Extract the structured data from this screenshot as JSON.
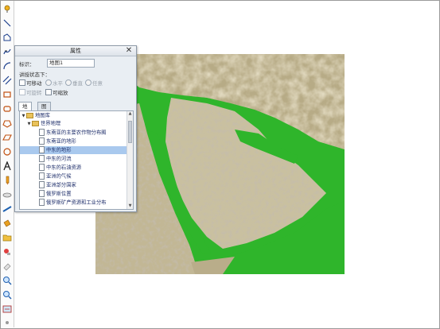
{
  "panel": {
    "title": "属性",
    "id_label": "标识：",
    "id_value": "地图1",
    "state_label": "讲授状态下：",
    "movable_label": "可移动",
    "h_label": "水平",
    "v_label": "垂直",
    "any_label": "任意",
    "rotatable_label": "可旋转",
    "scalable_label": "可缩放",
    "tabs": [
      "地图",
      "图层"
    ],
    "active_tab": 0
  },
  "tree": {
    "root": "地图库",
    "group": "世界地理",
    "items": [
      "东南亚的主要农作物分布图",
      "东南亚的地形",
      "中东的地形",
      "中东的河流",
      "中东的石油资源",
      "亚洲的气候",
      "亚洲部分国家",
      "俄罗斯位置",
      "俄罗斯矿产资源和工业分布"
    ],
    "selected_index": 2
  },
  "toolbar": {
    "icons": [
      "pin-icon",
      "line-icon",
      "polyline-icon",
      "freehand-icon",
      "arc-icon",
      "double-line-icon",
      "rectangle-icon",
      "rounded-rect-icon",
      "polygon-icon",
      "parallelogram-icon",
      "circle-icon",
      "text-icon",
      "pencil-icon",
      "ruler-icon",
      "line-style-icon",
      "paint-bucket-icon",
      "folder-icon",
      "stamp-icon",
      "eraser-icon",
      "zoom-in-icon",
      "zoom-out-icon",
      "map-icon"
    ]
  },
  "colors": {
    "map_land_low": "#2fb52b",
    "panel_bg": "#e9eef3",
    "selection": "#a9c9ee"
  }
}
